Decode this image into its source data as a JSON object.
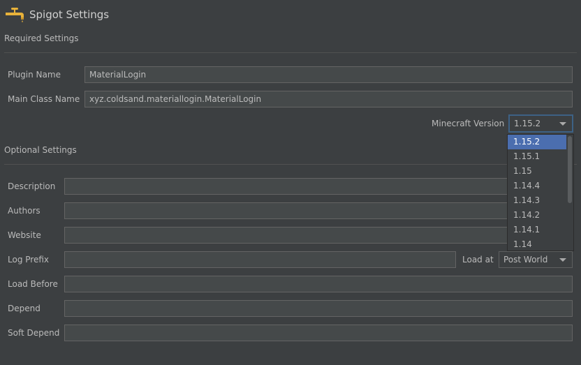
{
  "header": {
    "title": "Spigot Settings",
    "icon": "faucet-icon"
  },
  "required": {
    "section_label": "Required Settings",
    "plugin_name_label": "Plugin Name",
    "plugin_name_value": "MaterialLogin",
    "main_class_label": "Main Class Name",
    "main_class_value": "xyz.coldsand.materiallogin.MaterialLogin",
    "mc_version_label": "Minecraft Version",
    "mc_version_value": "1.15.2"
  },
  "version_popup": {
    "options": [
      "1.15.2",
      "1.15.1",
      "1.15",
      "1.14.4",
      "1.14.3",
      "1.14.2",
      "1.14.1",
      "1.14"
    ],
    "selected": "1.15.2"
  },
  "optional": {
    "section_label": "Optional Settings",
    "description_label": "Description",
    "description_value": "",
    "authors_label": "Authors",
    "authors_value": "",
    "website_label": "Website",
    "website_value": "",
    "log_prefix_label": "Log Prefix",
    "log_prefix_value": "",
    "load_at_label": "Load at",
    "load_at_value": "Post World",
    "load_before_label": "Load Before",
    "load_before_value": "",
    "depend_label": "Depend",
    "depend_value": "",
    "soft_depend_label": "Soft Depend",
    "soft_depend_value": ""
  },
  "colors": {
    "background": "#3c3f41",
    "field": "#45494a",
    "accent": "#4b6eaf",
    "icon": "#e8b23a"
  }
}
